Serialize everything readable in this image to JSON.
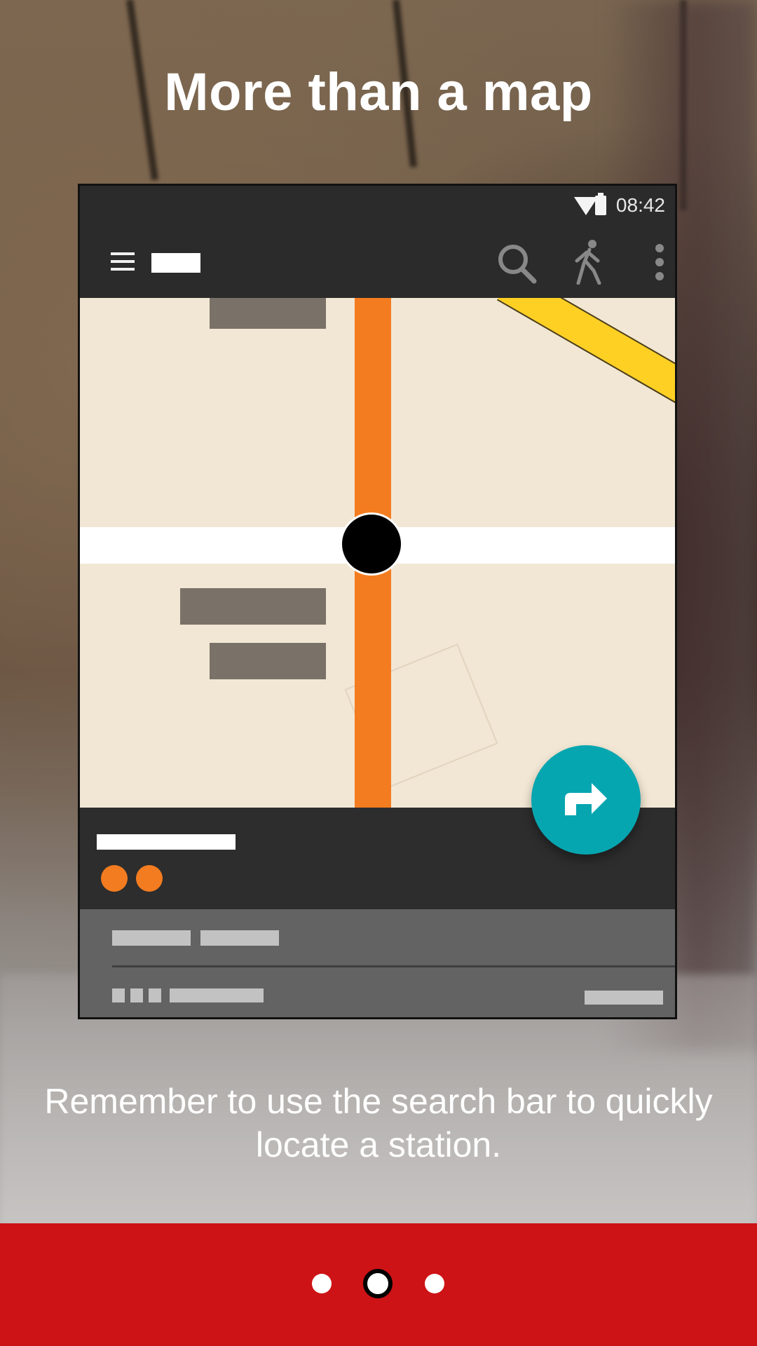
{
  "onboarding": {
    "title": "More than a map",
    "caption": "Remember to use the search bar to quickly locate a station.",
    "pager": {
      "pages": 3,
      "active_index": 1
    }
  },
  "mockup": {
    "status_time": "08:42",
    "icons": [
      "wifi-icon",
      "battery-icon",
      "menu-icon",
      "search-icon",
      "walk-icon",
      "more-vert-icon",
      "directions-icon"
    ]
  },
  "colors": {
    "footer": "#cd1316",
    "fab": "#06a6b0",
    "metro_line_orange": "#f47c20",
    "metro_line_yellow": "#fdd023"
  }
}
